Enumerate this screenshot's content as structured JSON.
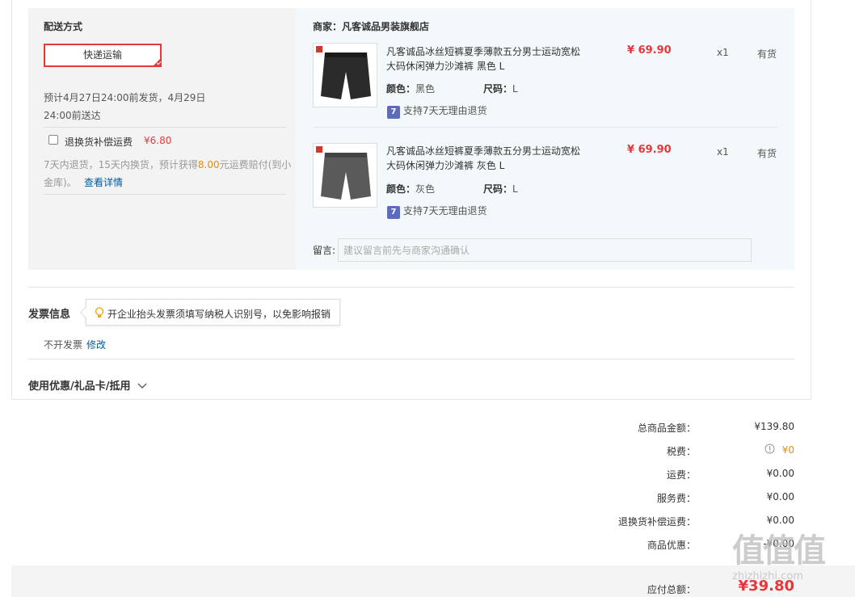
{
  "delivery": {
    "title": "配送方式",
    "method_button": "快递运输",
    "eta_line1": "预计4月27日24:00前发货，4月29日",
    "eta_line2": "24:00前送达",
    "return_shipping_label": "退换货补偿运费",
    "return_shipping_price": "¥6.80",
    "return_desc_part1": "7天内退货，15天内换货，预计获得",
    "return_desc_amount": "8.00",
    "return_desc_part2": "元运费赔付(到小",
    "return_desc_line2": "金库)。",
    "details_link": "查看详情"
  },
  "shop": {
    "label": "商家：凡客诚品男装旗舰店",
    "items": [
      {
        "title_line1": "凡客诚品冰丝短裤夏季薄款五分男士运动宽松",
        "title_line2": "大码休闲弹力沙滩裤 黑色 L",
        "price": "¥ 69.90",
        "qty": "x1",
        "stock": "有货",
        "color_label": "颜色：",
        "color_value": "黑色",
        "size_label": "尺码：",
        "size_value": "L",
        "return_badge": "7",
        "return_policy": "支持7天无理由退货",
        "color_hex": "#2a2a2a"
      },
      {
        "title_line1": "凡客诚品冰丝短裤夏季薄款五分男士运动宽松",
        "title_line2": "大码休闲弹力沙滩裤 灰色 L",
        "price": "¥ 69.90",
        "qty": "x1",
        "stock": "有货",
        "color_label": "颜色：",
        "color_value": "灰色",
        "size_label": "尺码：",
        "size_value": "L",
        "return_badge": "7",
        "return_policy": "支持7天无理由退货",
        "color_hex": "#5a5a5a"
      }
    ],
    "message_label": "留言:",
    "message_placeholder": "建议留言前先与商家沟通确认"
  },
  "invoice": {
    "title": "发票信息",
    "tip": "开企业抬头发票须填写纳税人识别号，以免影响报销",
    "status": "不开发票",
    "edit_link": "修改"
  },
  "discount": {
    "title": "使用优惠/礼品卡/抵用"
  },
  "summary": {
    "rows": [
      {
        "label": "总商品金额：",
        "value": "¥139.80"
      },
      {
        "label": "税费：",
        "value": "¥0"
      },
      {
        "label": "运费：",
        "value": "¥0.00"
      },
      {
        "label": "服务费：",
        "value": "¥0.00"
      },
      {
        "label": "退换货补偿运费：",
        "value": "¥0.00"
      },
      {
        "label": "商品优惠：",
        "value": "-¥0.00"
      }
    ],
    "total_label": "应付总额：",
    "total_value": "¥39.80"
  },
  "watermark": {
    "logo": "值值值",
    "url": "zhizhizhi.com"
  },
  "colors": {
    "accent_red": "#e4393c",
    "link_blue": "#005aa0",
    "panel_gray": "#f3f3f3",
    "panel_blue": "#f3f8fb"
  }
}
